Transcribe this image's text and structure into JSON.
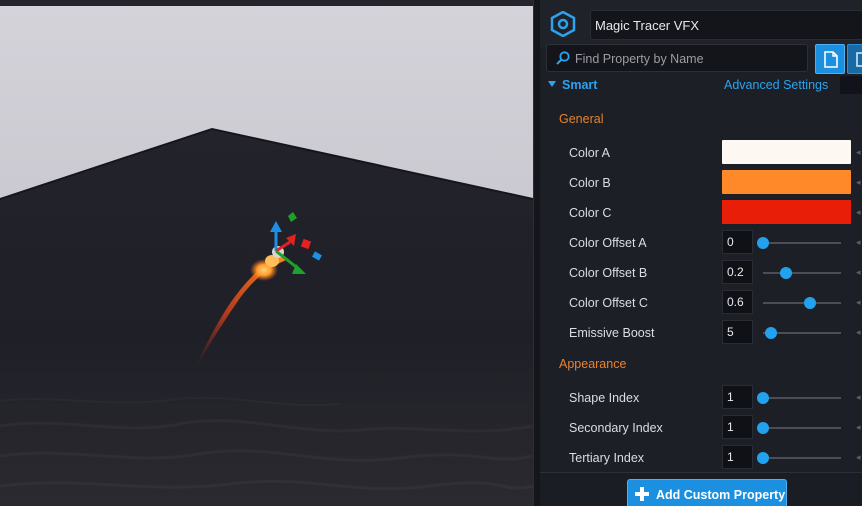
{
  "object": {
    "name": "Magic Tracer VFX",
    "icon": "vfx-object-icon"
  },
  "search": {
    "placeholder": "Find Property by Name",
    "icon": "search-icon"
  },
  "toolbar": {
    "primary_icon": "document-icon",
    "secondary_icon": "panel-icon"
  },
  "section": {
    "label": "Smart",
    "advanced_label": "Advanced Settings",
    "expanded": true
  },
  "groups": {
    "general": {
      "label": "General"
    },
    "appearance": {
      "label": "Appearance"
    }
  },
  "properties": {
    "color_a": {
      "label": "Color A",
      "color": "#fdf9f2"
    },
    "color_b": {
      "label": "Color B",
      "color": "#ff8828"
    },
    "color_c": {
      "label": "Color C",
      "color": "#e81e08"
    },
    "color_offset_a": {
      "label": "Color Offset A",
      "value": "0",
      "fraction": 0.0
    },
    "color_offset_b": {
      "label": "Color Offset B",
      "value": "0.2",
      "fraction": 0.3
    },
    "color_offset_c": {
      "label": "Color Offset C",
      "value": "0.6",
      "fraction": 0.6
    },
    "emissive_boost": {
      "label": "Emissive Boost",
      "value": "5",
      "fraction": 0.1
    },
    "shape_index": {
      "label": "Shape Index",
      "value": "1",
      "fraction": 0.0
    },
    "secondary_index": {
      "label": "Secondary Index",
      "value": "1",
      "fraction": 0.0
    },
    "tertiary_index": {
      "label": "Tertiary Index",
      "value": "1",
      "fraction": 0.0
    }
  },
  "add_button": {
    "label": "Add Custom Property",
    "icon": "plus-icon"
  },
  "colors": {
    "accent": "#1b8fe0",
    "group_label": "#e7822c",
    "section_label": "#2ba3ee"
  }
}
